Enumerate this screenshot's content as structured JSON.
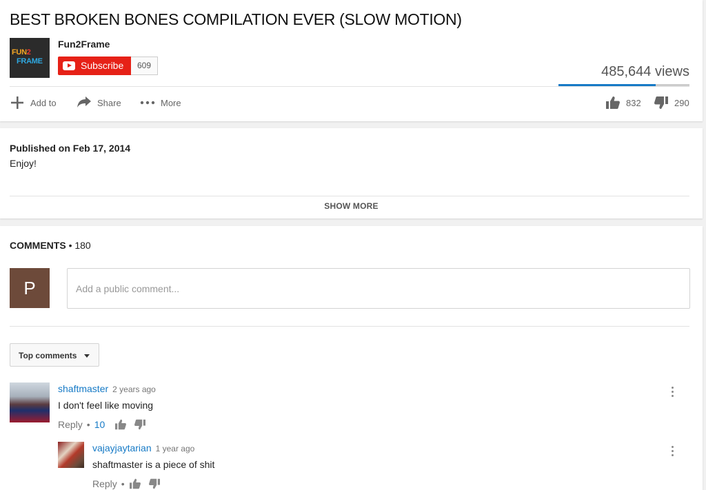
{
  "video": {
    "title": "BEST BROKEN BONES COMPILATION EVER (SLOW MOTION)",
    "channel": {
      "logo_line1_a": "FUN",
      "logo_line1_b": "2",
      "logo_line2": "FRAME",
      "name": "Fun2Frame",
      "subscribe_label": "Subscribe",
      "subscriber_count": "609"
    },
    "views": "485,644 views",
    "like_ratio": 0.74,
    "actions": {
      "add_to": "Add to",
      "share": "Share",
      "more": "More",
      "likes": "832",
      "dislikes": "290"
    }
  },
  "description": {
    "published": "Published on Feb 17, 2014",
    "text": "Enjoy!",
    "show_more": "SHOW MORE"
  },
  "comments": {
    "heading": "COMMENTS",
    "separator": "•",
    "count": "180",
    "avatar_letter": "P",
    "placeholder": "Add a public comment...",
    "sort_label": "Top comments",
    "items": [
      {
        "author": "shaftmaster",
        "time": "2 years ago",
        "text": "I don't feel like moving",
        "reply_label": "Reply",
        "dot": "•",
        "likes": "10"
      },
      {
        "author": "vajayjaytarian",
        "time": "1 year ago",
        "text": "shaftmaster is a piece of shit",
        "reply_label": "Reply",
        "dot": "•"
      }
    ]
  },
  "colors": {
    "brand_red": "#e62117",
    "link_blue": "#167ac6",
    "views_bar_fill": "#167ac6"
  },
  "icons": [
    "plus-icon",
    "share-arrow-icon",
    "more-dots-icon",
    "thumbs-up-icon",
    "thumbs-down-icon",
    "youtube-play-icon",
    "caret-down-icon",
    "kebab-menu-icon"
  ]
}
